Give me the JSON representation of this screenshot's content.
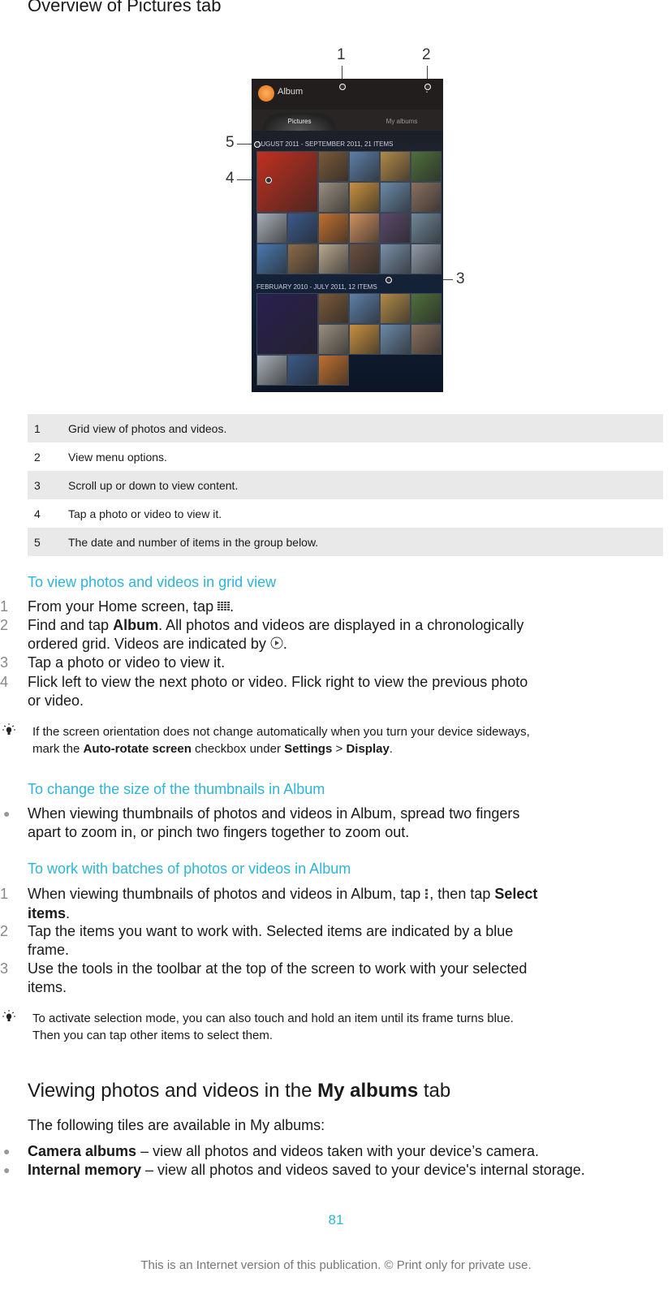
{
  "page_title": "Overview of Pictures tab",
  "figure": {
    "callouts": [
      "1",
      "2",
      "3",
      "4",
      "5"
    ],
    "app_title": "Album",
    "tabs": [
      {
        "label": "Pictures",
        "active": true
      },
      {
        "label": "My albums",
        "active": false
      }
    ],
    "groups": [
      {
        "header": "AUGUST 2011 - SEPTEMBER 2011, 21 ITEMS"
      },
      {
        "header": "FEBRUARY 2010 - JULY 2011, 12 ITEMS"
      }
    ]
  },
  "legend": [
    {
      "num": "1",
      "text": "Grid view of photos and videos."
    },
    {
      "num": "2",
      "text": "View menu options."
    },
    {
      "num": "3",
      "text": "Scroll up or down to view content."
    },
    {
      "num": "4",
      "text": "Tap a photo or video to view it."
    },
    {
      "num": "5",
      "text": "The date and number of items in the group below."
    }
  ],
  "section1": {
    "heading": "To view photos and videos in grid view",
    "steps": [
      {
        "num": "1",
        "pre": "From your Home screen, tap ",
        "post": "."
      },
      {
        "num": "2",
        "pre": "Find and tap ",
        "bold": "Album",
        "post": ". All photos and videos are displayed in a chronologically",
        "line2_pre": "ordered grid. Videos are indicated by ",
        "line2_post": "."
      },
      {
        "num": "3",
        "text": "Tap a photo or video to view it."
      },
      {
        "num": "4",
        "line1": "Flick left to view the next photo or video. Flick right to view the previous photo",
        "line2": "or video."
      }
    ],
    "tip": {
      "line1": "If the screen orientation does not change automatically when you turn your device sideways,",
      "pre": "mark the ",
      "b1": "Auto-rotate screen",
      "mid": " checkbox under ",
      "b2": "Settings",
      "sep": " > ",
      "b3": "Display",
      "post": "."
    }
  },
  "section2": {
    "heading": "To change the size of the thumbnails in Album",
    "bullet_line1": "When viewing thumbnails of photos and videos in Album, spread two fingers",
    "bullet_line2": "apart to zoom in, or pinch two fingers together to zoom out."
  },
  "section3": {
    "heading": "To work with batches of photos or videos in Album",
    "steps": [
      {
        "num": "1",
        "pre": "When viewing thumbnails of photos and videos in Album, tap ",
        "mid": ", then tap ",
        "bold1": "Select",
        "bold2": "items",
        "post": "."
      },
      {
        "num": "2",
        "line1": "Tap the items you want to work with. Selected items are indicated by a blue",
        "line2": "frame."
      },
      {
        "num": "3",
        "line1": "Use the tools in the toolbar at the top of the screen to work with your selected",
        "line2": "items."
      }
    ],
    "tip_line1": "To activate selection mode, you can also touch and hold an item until its frame turns blue.",
    "tip_line2": "Then you can tap other items to select them."
  },
  "section4": {
    "heading_pre": "Viewing photos and videos in the ",
    "heading_bold": "My albums",
    "heading_post": " tab",
    "intro": "The following tiles are available in My albums:",
    "bullets": [
      {
        "bold": "Camera albums",
        "text": " – view all photos and videos taken with your device’s camera."
      },
      {
        "bold": "Internal memory",
        "text": " – view all photos and videos saved to your device's internal storage."
      }
    ]
  },
  "page_number": "81",
  "footer": "This is an Internet version of this publication. © Print only for private use.",
  "colors": {
    "accent": "#2eb4d8",
    "table_stripe": "#e9e9e9"
  }
}
